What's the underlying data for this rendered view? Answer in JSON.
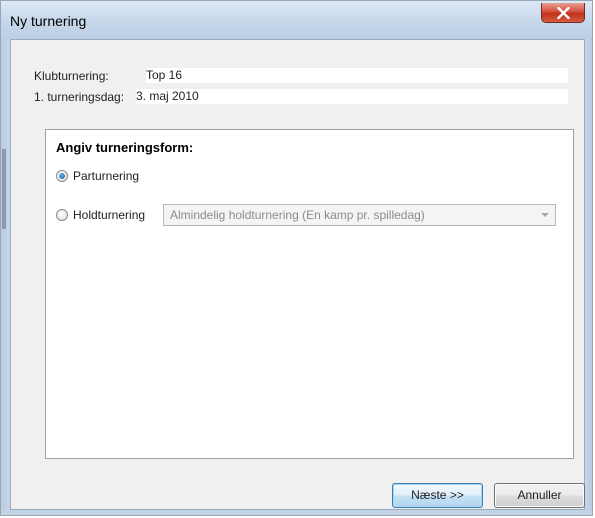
{
  "window": {
    "title": "Ny turnering"
  },
  "tournament_info": {
    "club_label": "Klubturnering:",
    "club_value": "Top 16",
    "date_label": "1. turneringsdag:",
    "date_value": "3. maj 2010"
  },
  "form_group": {
    "title": "Angiv turneringsform:",
    "options": [
      {
        "label": "Parturnering",
        "checked": true
      },
      {
        "label": "Holdturnering",
        "checked": false
      }
    ],
    "team_type_select": {
      "selected": "Almindelig holdturnering (En kamp pr. spilledag)",
      "enabled": false
    }
  },
  "buttons": {
    "next": "Næste >>",
    "cancel": "Annuller"
  },
  "colors": {
    "titlebar": "#c6d7ea",
    "close_button": "#c1301a",
    "radio_selected": "#1c5fb8",
    "default_button_border": "#3c7fb1"
  },
  "icons": {
    "close": "close-icon",
    "dropdown": "chevron-down-icon"
  }
}
